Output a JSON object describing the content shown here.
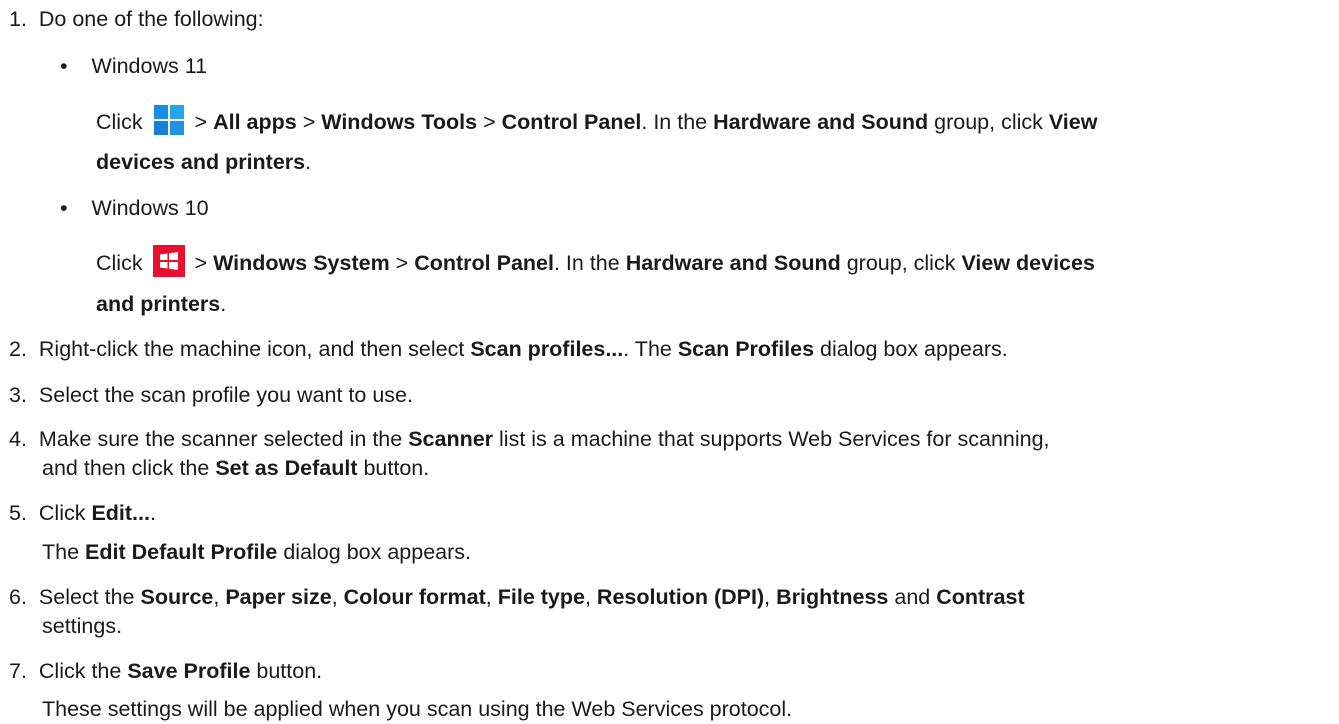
{
  "steps": [
    {
      "num": "1.",
      "text": "Do one of the following:"
    },
    {
      "num": "2.",
      "t1": "Right-click the machine icon, and then select ",
      "b1": "Scan profiles...",
      "t2": ". The ",
      "b2": "Scan Profiles",
      "t3": " dialog box appears."
    },
    {
      "num": "3.",
      "text": "Select the scan profile you want to use."
    },
    {
      "num": "4.",
      "t1": "Make sure the scanner selected in the ",
      "b1": "Scanner",
      "t2": " list is a machine that supports Web Services for scanning,",
      "line2_t1": "and then click the ",
      "line2_b1": "Set as Default",
      "line2_t2": " button."
    },
    {
      "num": "5.",
      "t1": "Click ",
      "b1": "Edit...",
      "t2": ".",
      "line2_t1": "The ",
      "line2_b1": "Edit Default Profile",
      "line2_t2": " dialog box appears."
    },
    {
      "num": "6.",
      "t1": "Select the ",
      "b1": "Source",
      "t2": ", ",
      "b2": "Paper size",
      "t3": ", ",
      "b3": "Colour format",
      "t4": ", ",
      "b4": "File type",
      "t5": ", ",
      "b5": "Resolution (DPI)",
      "t6": ", ",
      "b6": "Brightness",
      "t7": " and ",
      "b7": "Contrast",
      "line2_t1": "settings."
    },
    {
      "num": "7.",
      "t1": "Click the ",
      "b1": "Save Profile",
      "t2": " button.",
      "line2_t1": "These settings will be applied when you scan using the Web Services protocol."
    }
  ],
  "windows11": {
    "bullet": "•",
    "label": "Windows 11",
    "t1": "Click ",
    "b1": "All apps",
    "sep": " > ",
    "b2": "Windows Tools",
    "b3": "Control Panel",
    "t2": ". In the ",
    "b4": "Hardware and Sound",
    "t3": " group, click ",
    "b5": "View",
    "b6": "devices and printers",
    "t4": ".",
    "icon": "windows-11-start-icon",
    "icon_color": "#1f8fe0"
  },
  "windows10": {
    "bullet": "•",
    "label": "Windows 10",
    "t1": "Click ",
    "b1": "Windows System",
    "sep": " > ",
    "b2": "Control Panel",
    "t2": ". In the ",
    "b3": "Hardware and Sound",
    "t3": " group, click ",
    "b4": "View devices",
    "b5": "and printers",
    "t4": ".",
    "icon": "windows-10-start-icon",
    "icon_color": "#e8102d"
  }
}
